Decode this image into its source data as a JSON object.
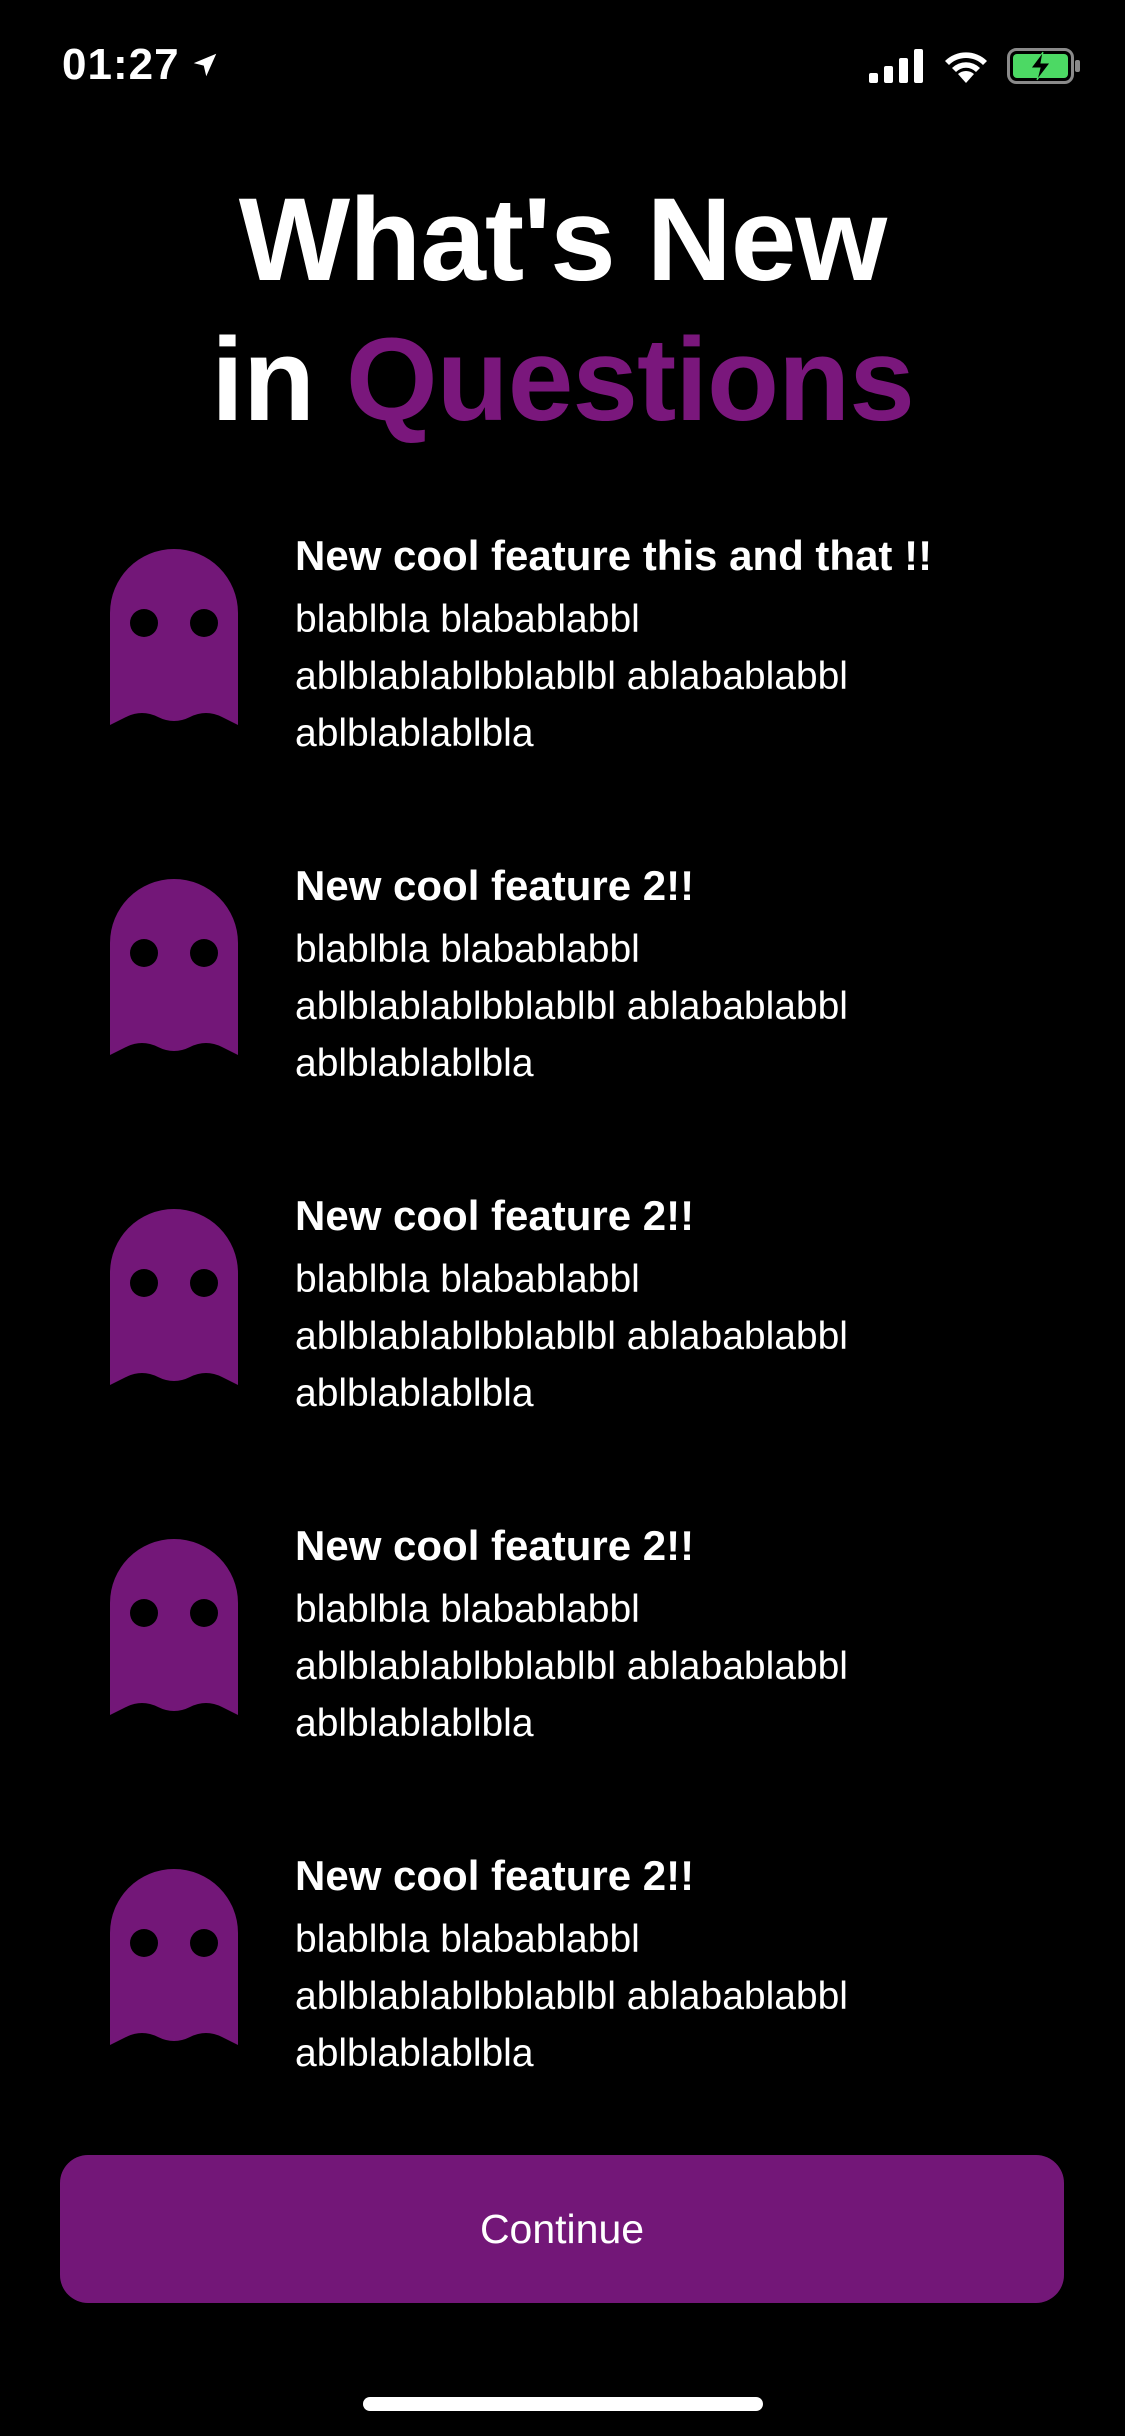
{
  "status_bar": {
    "time": "01:27",
    "icons": [
      "location-arrow-icon",
      "cellular-signal-icon",
      "wifi-icon",
      "battery-charging-icon"
    ],
    "battery_color": "#4cd964"
  },
  "title": {
    "line1": "What's New",
    "line2_prefix": "in",
    "line2_accent": "Questions",
    "accent_color": "#7a177c"
  },
  "features": [
    {
      "icon": "ghost-icon",
      "title": "New cool feature this and that !!",
      "desc_lines": [
        "blablbla blabablabbl",
        "ablblablablbblablbl ablabablabbl",
        "ablblablablbla"
      ]
    },
    {
      "icon": "ghost-icon",
      "title": "New cool feature 2!!",
      "desc_lines": [
        "blablbla blabablabbl",
        "ablblablablbblablbl ablabablabbl",
        "ablblablablbla"
      ]
    },
    {
      "icon": "ghost-icon",
      "title": "New cool feature 2!!",
      "desc_lines": [
        "blablbla blabablabbl",
        "ablblablablbblablbl ablabablabbl",
        "ablblablablbla"
      ]
    },
    {
      "icon": "ghost-icon",
      "title": "New cool feature 2!!",
      "desc_lines": [
        "blablbla blabablabbl",
        "ablblablablbblablbl ablabablabbl",
        "ablblablablbla"
      ]
    },
    {
      "icon": "ghost-icon",
      "title": "New cool feature 2!!",
      "desc_lines": [
        "blablbla blabablabbl",
        "ablblablablbblablbl ablabablabbl",
        "ablblablablbla"
      ]
    }
  ],
  "continue_button": {
    "label": "Continue",
    "color": "#731778"
  }
}
